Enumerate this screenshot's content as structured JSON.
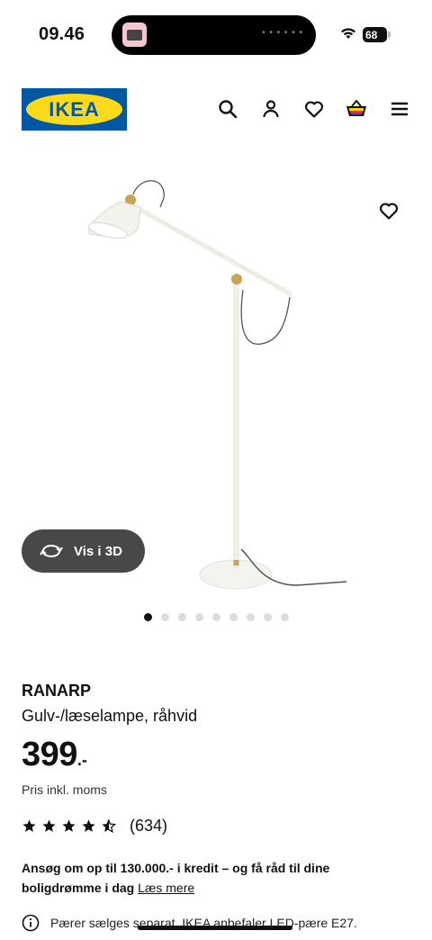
{
  "status_bar": {
    "time": "09.46",
    "battery": "68"
  },
  "header": {
    "logo_text": "IKEA",
    "icons": [
      "search-icon",
      "user-icon",
      "heart-icon",
      "basket-icon",
      "menu-icon"
    ]
  },
  "gallery": {
    "view_3d_label": "Vis i 3D",
    "dot_count": 9,
    "active_dot": 0
  },
  "product": {
    "name": "RANARP",
    "description": "Gulv-/læselampe, råhvid",
    "price_int": "399",
    "price_suffix": ".-",
    "vat_note": "Pris inkl. moms",
    "rating": 4.5,
    "rating_count": "(634)"
  },
  "credit": {
    "text": "Ansøg om op til 130.000.- i kredit – og få råd til dine boligdrømme i dag",
    "link": "Læs mere"
  },
  "note": {
    "text": "Pærer sælges separat. IKEA anbefaler LED-pære E27."
  },
  "colors": {
    "ikea_blue": "#0058a3",
    "ikea_yellow": "#ffda1a",
    "button_dark": "#484848"
  }
}
